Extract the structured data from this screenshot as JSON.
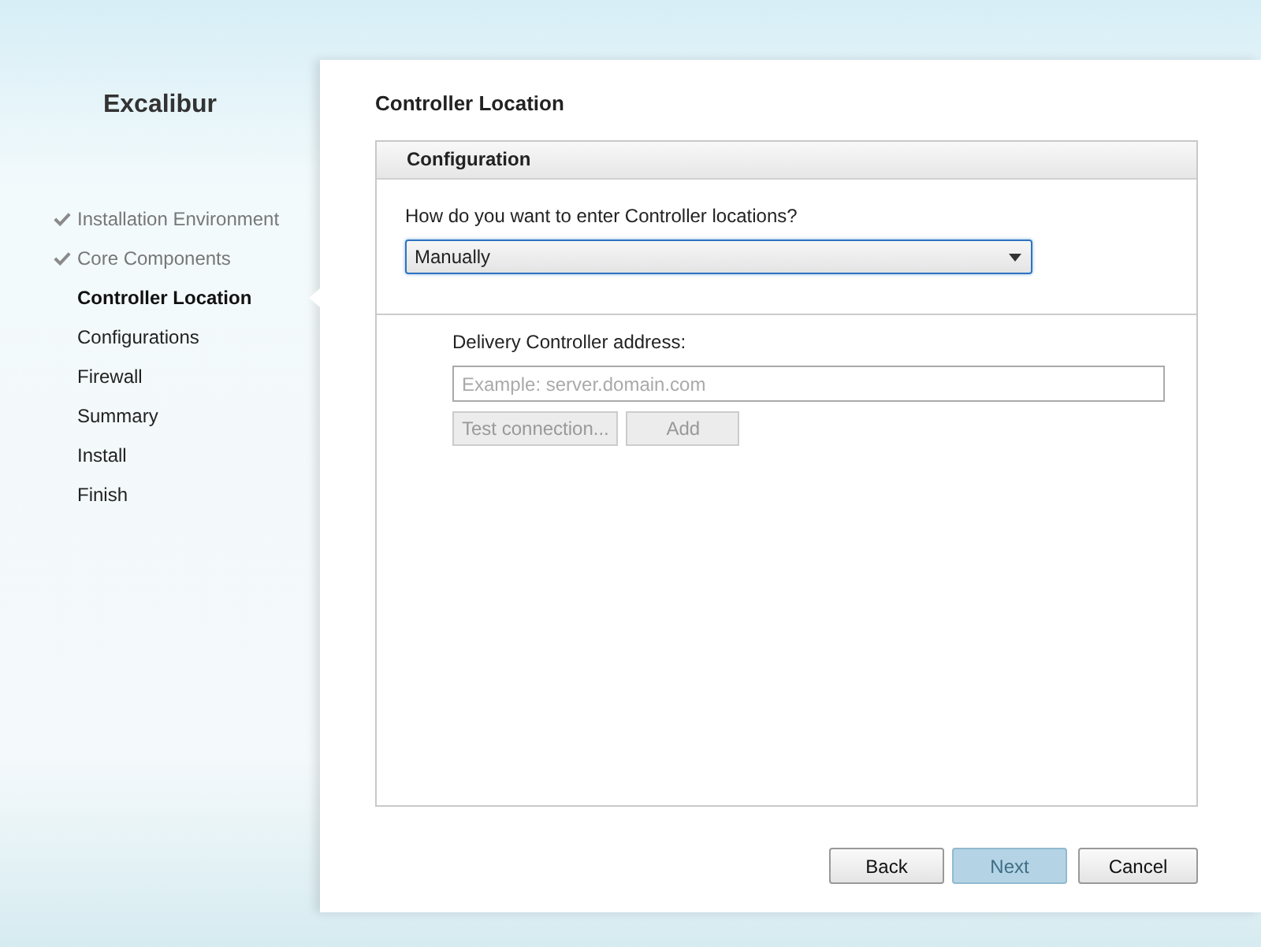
{
  "product": "Excalibur",
  "steps": [
    {
      "label": "Installation Environment",
      "done": true,
      "selected": false
    },
    {
      "label": "Core Components",
      "done": true,
      "selected": false
    },
    {
      "label": "Controller Location",
      "done": false,
      "selected": true
    },
    {
      "label": "Configurations",
      "done": false,
      "selected": false
    },
    {
      "label": "Firewall",
      "done": false,
      "selected": false
    },
    {
      "label": "Summary",
      "done": false,
      "selected": false
    },
    {
      "label": "Install",
      "done": false,
      "selected": false
    },
    {
      "label": "Finish",
      "done": false,
      "selected": false
    }
  ],
  "page_title": "Controller Location",
  "section": {
    "title": "Configuration",
    "question": "How do you want to enter Controller locations?",
    "mode": "Manually",
    "address_label": "Delivery Controller address:",
    "address": {
      "placeholder": "Example: server.domain.com"
    },
    "buttons": [
      {
        "label": "Test connection...",
        "disabled": true
      },
      {
        "label": "Add",
        "disabled": true
      }
    ]
  },
  "footer_buttons": [
    {
      "label": "Back",
      "disabled": false
    },
    {
      "label": "Next",
      "disabled": true
    },
    {
      "label": "Cancel",
      "disabled": false
    }
  ]
}
